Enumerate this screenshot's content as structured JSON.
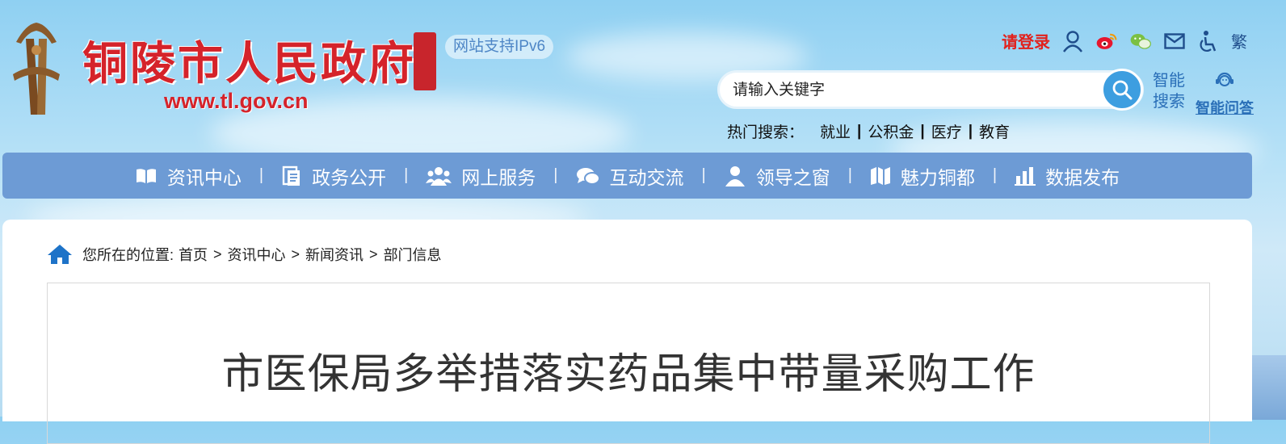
{
  "header": {
    "site_title": "铜陵市人民政府",
    "site_url": "www.tl.gov.cn",
    "seal_text": "铜陵",
    "ipv6": "网站支持IPv6"
  },
  "toplinks": {
    "login": "请登录",
    "traditional": "繁"
  },
  "search": {
    "placeholder": "请输入关键字",
    "smart_search_label": "智能搜索",
    "smart_qa_label": "智能问答",
    "hot_label": "热门搜索：",
    "hot_items": [
      "就业",
      "公积金",
      "医疗",
      "教育"
    ]
  },
  "nav": {
    "items": [
      {
        "label": "资讯中心",
        "icon": "book-icon"
      },
      {
        "label": "政务公开",
        "icon": "document-icon"
      },
      {
        "label": "网上服务",
        "icon": "people-icon"
      },
      {
        "label": "互动交流",
        "icon": "chat-icon"
      },
      {
        "label": "领导之窗",
        "icon": "person-icon"
      },
      {
        "label": "魅力铜都",
        "icon": "map-icon"
      },
      {
        "label": "数据发布",
        "icon": "bar-chart-icon"
      }
    ]
  },
  "breadcrumb": {
    "prefix": "您所在的位置:",
    "items": [
      "首页",
      "资讯中心",
      "新闻资讯",
      "部门信息"
    ]
  },
  "article": {
    "title": "市医保局多举措落实药品集中带量采购工作"
  },
  "colors": {
    "brand_red": "#d5232a",
    "nav_bg": "#6d9bd5",
    "link_blue": "#2a6fb8"
  }
}
